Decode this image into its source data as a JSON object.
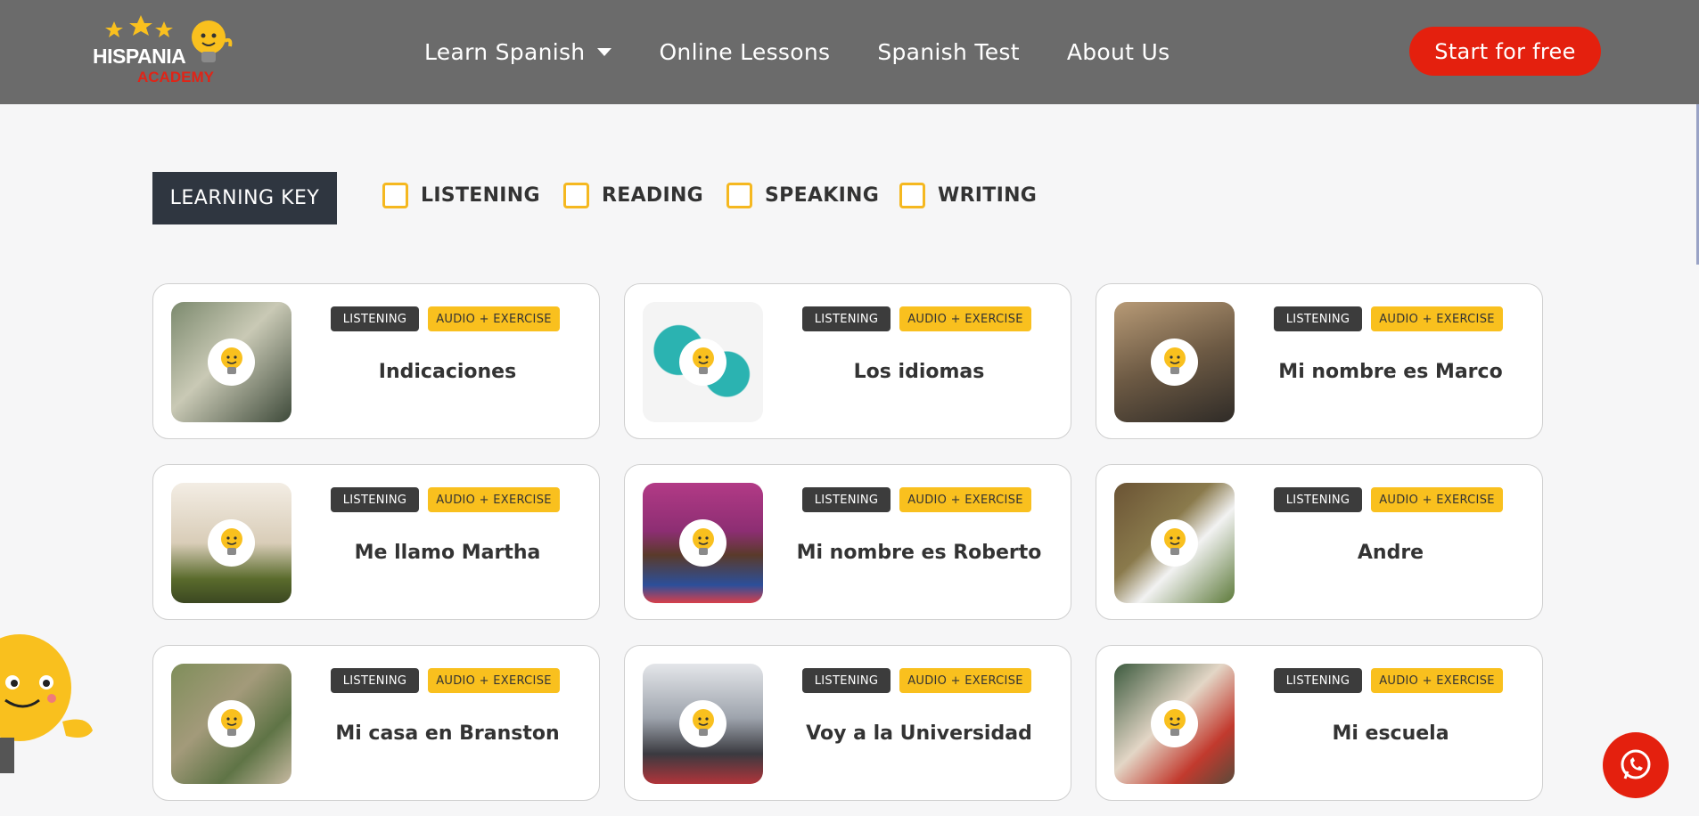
{
  "brand": {
    "name_main": "HISPANIA",
    "name_sub": "ACADEMY",
    "accent": "#e4200e",
    "yellow": "#f9c01e"
  },
  "nav": {
    "items": [
      {
        "label": "Learn Spanish",
        "has_dropdown": true
      },
      {
        "label": "Online Lessons"
      },
      {
        "label": "Spanish Test"
      },
      {
        "label": "About Us"
      }
    ],
    "cta": "Start for free"
  },
  "learning_key": {
    "title": "LEARNING KEY",
    "filters": [
      {
        "label": "LISTENING",
        "checked": false
      },
      {
        "label": "READING",
        "checked": false
      },
      {
        "label": "SPEAKING",
        "checked": false
      },
      {
        "label": "WRITING",
        "checked": false
      }
    ]
  },
  "lessons": [
    {
      "skill": "LISTENING",
      "type": "AUDIO + EXERCISE",
      "title": "Indicaciones"
    },
    {
      "skill": "LISTENING",
      "type": "AUDIO + EXERCISE",
      "title": "Los idiomas"
    },
    {
      "skill": "LISTENING",
      "type": "AUDIO + EXERCISE",
      "title": "Mi nombre es Marco"
    },
    {
      "skill": "LISTENING",
      "type": "AUDIO + EXERCISE",
      "title": "Me llamo Martha"
    },
    {
      "skill": "LISTENING",
      "type": "AUDIO + EXERCISE",
      "title": "Mi nombre es Roberto"
    },
    {
      "skill": "LISTENING",
      "type": "AUDIO + EXERCISE",
      "title": "Andre"
    },
    {
      "skill": "LISTENING",
      "type": "AUDIO + EXERCISE",
      "title": "Mi casa en Branston"
    },
    {
      "skill": "LISTENING",
      "type": "AUDIO + EXERCISE",
      "title": "Voy a la Universidad"
    },
    {
      "skill": "LISTENING",
      "type": "AUDIO + EXERCISE",
      "title": "Mi escuela"
    }
  ],
  "icons": {
    "whatsapp": "whatsapp-icon",
    "mascot": "lightbulb-mascot"
  }
}
